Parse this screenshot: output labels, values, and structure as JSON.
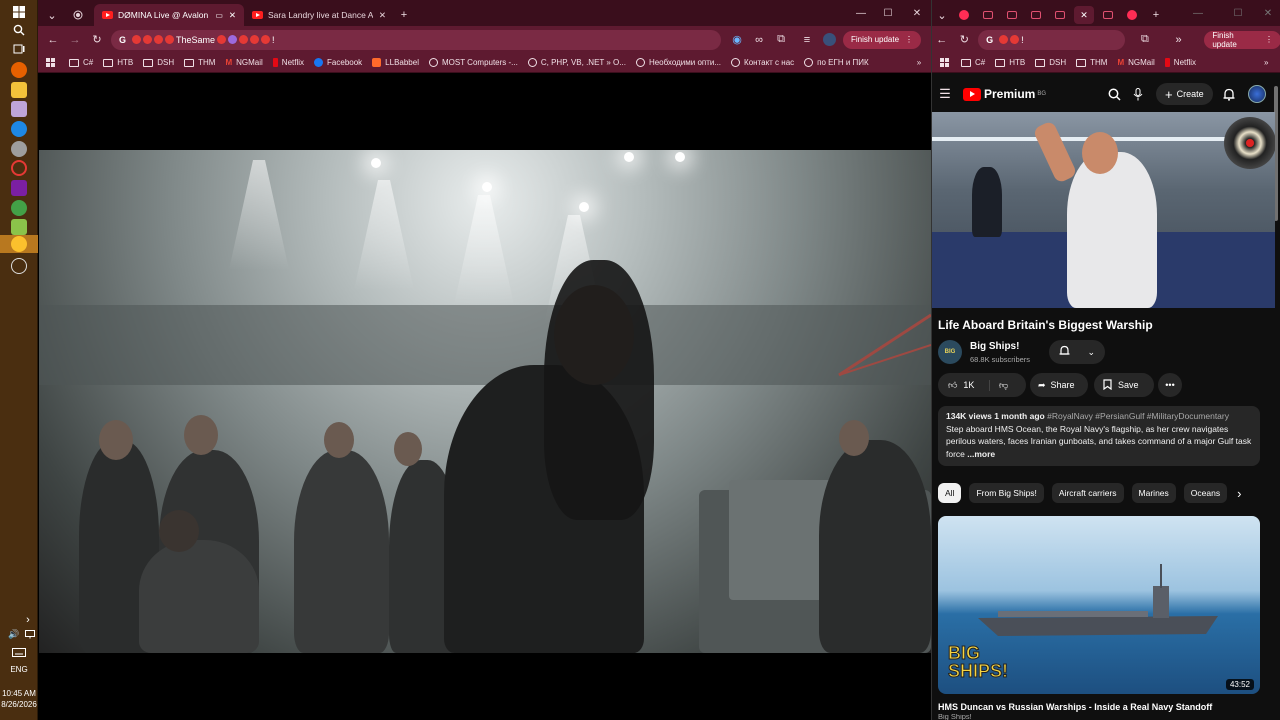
{
  "taskbar": {
    "language": "ENG",
    "time": "10:45 AM",
    "date": "8/26/2026"
  },
  "left_browser": {
    "tabs": [
      {
        "label": "DØMINA Live @ Avalon M",
        "active": true
      },
      {
        "label": "Sara Landry live at Dance A",
        "active": false
      }
    ],
    "new_tab_label": "+",
    "address_text": "TheSame",
    "address_suffix": "!",
    "finish_update_label": "Finish update",
    "bookmarks": [
      "C#",
      "HTB",
      "DSH",
      "THM",
      "NGMail",
      "Netflix",
      "Facebook",
      "LLBabbel",
      "MOST Computers -...",
      "C, PHP, VB, .NET » O...",
      "Необходими опти...",
      "Контакт с нас",
      "по ЕГН и ПИК"
    ],
    "bookmarks_more": "»"
  },
  "right_browser": {
    "address_suffix": "!",
    "finish_update_label": "Finish update",
    "bookmarks": [
      "C#",
      "HTB",
      "DSH",
      "THM",
      "NGMail",
      "Netflix"
    ],
    "bookmarks_more": "»",
    "youtube": {
      "logo_text": "Premium",
      "logo_region": "BG",
      "create_label": "Create",
      "video_title": "Life Aboard Britain's Biggest Warship",
      "channel_name": "Big Ships!",
      "channel_avatar_text": "BIG",
      "subscribers": "68.8K subscribers",
      "likes": "1K",
      "share_label": "Share",
      "save_label": "Save",
      "description_meta": "134K views  1 month ago",
      "description_tags": "#RoyalNavy #PersianGulf #MilitaryDocumentary",
      "description_text": "Step aboard HMS Ocean, the Royal Navy's flagship, as her crew navigates perilous waters, faces Iranian gunboats, and takes command of a major Gulf task force",
      "description_more": "...more",
      "chips": [
        "All",
        "From Big Ships!",
        "Aircraft carriers",
        "Marines",
        "Oceans"
      ],
      "rec_thumb_text": "BIG SHIPS!",
      "rec_duration": "43:52",
      "rec_title": "HMS Duncan vs Russian Warships - Inside a Real Navy Standoff",
      "rec_channel": "Big Ships!"
    }
  },
  "colors": {
    "browser_frame": "#5e1a30",
    "tabstrip": "#3a0e1c",
    "taskbar": "#4a2e10",
    "youtube_bg": "#0f0f0f",
    "youtube_red": "#ff0000"
  }
}
